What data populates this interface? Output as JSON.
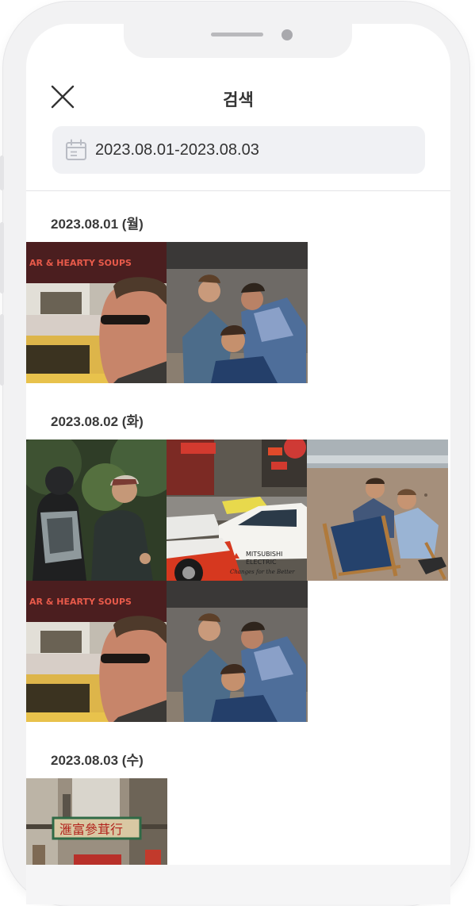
{
  "header": {
    "title": "검색"
  },
  "search": {
    "date_range": "2023.08.01-2023.08.03"
  },
  "groups": [
    {
      "date_label": "2023.08.01 (월)",
      "photos": [
        "man-sunglasses-street",
        "men-talking-stairs"
      ]
    },
    {
      "date_label": "2023.08.02 (화)",
      "photos": [
        "backpackers-woods",
        "red-taxi-city",
        "men-beach-chairs",
        "man-sunglasses-street",
        "men-talking-stairs"
      ]
    },
    {
      "date_label": "2023.08.03 (수)",
      "photos": [
        "hongkong-street-sign"
      ]
    }
  ],
  "photo_text": {
    "bar_sign": "AR & HEARTY SOUPS",
    "taxi_logo_1": "MITSUBISHI",
    "taxi_logo_2": "ELECTRIC",
    "taxi_slogan": "Changes for the Better",
    "hk_sign": "滙富參茸行"
  }
}
